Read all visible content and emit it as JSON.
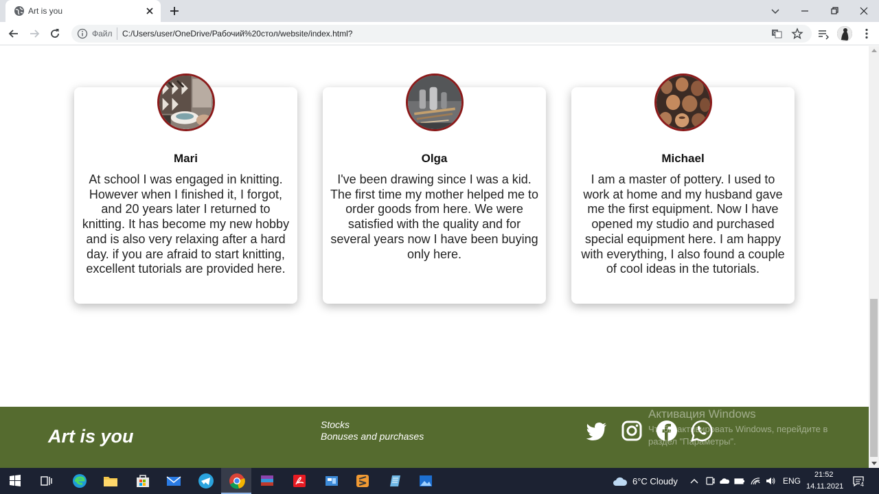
{
  "browser": {
    "tab_title": "Art is you",
    "url_scheme": "Файл",
    "url": "C:/Users/user/OneDrive/Рабочий%20стол/website/index.html?"
  },
  "cards": [
    {
      "name": "Mari",
      "text": "At school I was engaged in knitting. However when I finished it, I forgot, and 20 years later I returned to knitting. It has become my new hobby and is also very relaxing after a hard day. if you are afraid to start knitting, excellent tutorials are provided here."
    },
    {
      "name": "Olga",
      "text": "I've been drawing since I was a kid. The first time my mother helped me to order goods from here. We were satisfied with the quality and for several years now I have been buying only here."
    },
    {
      "name": "Michael",
      "text": "I am a master of pottery. I used to work at home and my husband gave me the first equipment. Now I have opened my studio and purchased special equipment here. I am happy with everything, I also found a couple of cool ideas in the tutorials."
    }
  ],
  "footer": {
    "brand": "Art is you",
    "links": [
      "Stocks",
      "Bonuses and purchases"
    ],
    "social": [
      "twitter-icon",
      "instagram-icon",
      "facebook-icon",
      "whatsapp-icon"
    ]
  },
  "watermark": {
    "title": "Активация Windows",
    "text": "Чтобы активировать Windows, перейдите в раздел \"Параметры\"."
  },
  "taskbar": {
    "weather": "6°C  Cloudy",
    "lang": "ENG",
    "time": "21:52",
    "date": "14.11.2021",
    "notifications": "4"
  },
  "colors": {
    "footer_bg": "#556b2f",
    "avatar_border": "#8b1a1a"
  }
}
